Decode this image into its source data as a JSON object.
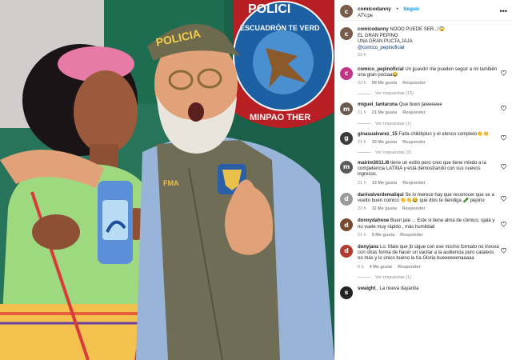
{
  "header": {
    "username": "comicodanny",
    "follow_label": "Seguir",
    "location": "ATV.pe"
  },
  "photo": {
    "cap_text": "POLICIA",
    "badge_text": "FMA",
    "crest_text_top": "POLICI",
    "crest_text_ring": "ESCUADRÓN TE VERD",
    "crest_text_bottom": "MINPAO THER"
  },
  "caption": {
    "username": "comicodanny",
    "line1": "NOOO PUEDE SER...!😱",
    "line2": "EL GRAN PEPINO",
    "line3": "UNA GRAN PUCTA,JAJA",
    "mention": "@comico_pepinoficial",
    "time": "22 h"
  },
  "comments": [
    {
      "username": "comico_pepinoficial",
      "text": "Un jjuavdrr me pueden seguir a mi también una gran poctaa😂",
      "time": "22 h",
      "likes": "99 Me gusta",
      "reply": "Responder",
      "view_replies": "Ver respuestas (15)",
      "avatar_color": "#c13584",
      "avatar_letter": "c"
    },
    {
      "username": "miguel_tantaruna",
      "text": "Que buen jaieeeeee",
      "time": "21 h",
      "likes": "21 Me gusta",
      "reply": "Responder",
      "view_replies": "Ver respuestas (1)",
      "avatar_color": "#6b5b4e",
      "avatar_letter": "m"
    },
    {
      "username": "ginasualvarez_15",
      "text": "Faita chikitiplun y el elenco completo👏👏",
      "time": "21 h",
      "likes": "30 Me gusta",
      "reply": "Responder",
      "view_replies": "Ver respuestas (2)",
      "avatar_color": "#3b3b3b",
      "avatar_letter": "g"
    },
    {
      "username": "mairim3011.l8",
      "text": "tiene un estilo pero creo que tiene miedo a la competencia LATINA y está demostrando con sus nuevos ingresos.",
      "time": "21 h",
      "likes": "13 Me gusta",
      "reply": "Responder",
      "view_replies": "",
      "avatar_color": "#5a5a5a",
      "avatar_letter": "m"
    },
    {
      "username": "danivalverdemaliqui",
      "text": "Se lo merece hay que reconocer que se a vuelto buen comico 👏👏😂 que dios te bendiga 🥒 pepino",
      "time": "22 h",
      "likes": "11 Me gusta",
      "reply": "Responder",
      "view_replies": "",
      "avatar_color": "#9a9a9a",
      "avatar_letter": "d"
    },
    {
      "username": "donnydahnoe",
      "text": "Buen jaie ... Este si tiene alma de cómico, ojalá y no vuele muy rápido , más humildad",
      "time": "21 h",
      "likes": "9 Me gusta",
      "reply": "Responder",
      "view_replies": "",
      "avatar_color": "#7a4a2e",
      "avatar_letter": "d"
    },
    {
      "username": "donyjans",
      "text": "Lo. Malo que jb sigue con ese mismo formato no innova con otras forma de hacer un vacilar a la audiencia puro calateos no más y lo único bueno la tía Gloria bueeeeeenaaaaa",
      "time": "8 h",
      "likes": "4 Me gusta",
      "reply": "Responder",
      "view_replies": "Ver respuestas (1)",
      "avatar_color": "#b23a2e",
      "avatar_letter": "d"
    },
    {
      "username": "swaight_",
      "text": "La nueva dayanita",
      "time": "",
      "likes": "",
      "reply": "",
      "view_replies": "",
      "avatar_color": "#222222",
      "avatar_letter": "s"
    }
  ],
  "colors": {
    "follow": "#0095f6",
    "muted": "#8e8e8e",
    "text": "#262626"
  }
}
